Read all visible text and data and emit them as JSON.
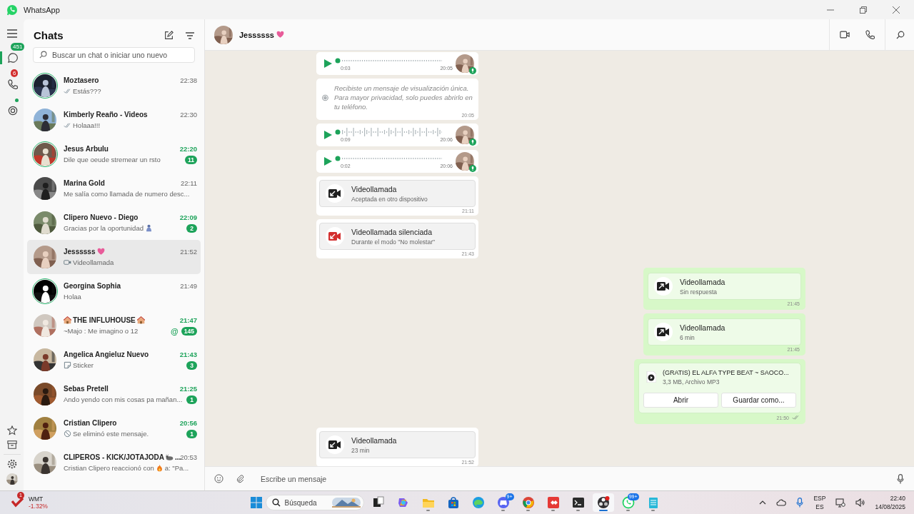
{
  "window": {
    "title": "WhatsApp"
  },
  "rail": {
    "items": [
      {
        "kind": "chats",
        "badge": "451",
        "selected": true
      },
      {
        "kind": "calls",
        "badge": "6",
        "selected": false
      },
      {
        "kind": "status",
        "dot": true,
        "selected": false
      }
    ]
  },
  "chat_list": {
    "title": "Chats",
    "search": {
      "placeholder": "Buscar un chat o iniciar uno nuevo"
    },
    "chats": [
      {
        "name": [
          {
            "kind": "text",
            "text": "Moztasero"
          }
        ],
        "time": "22:38",
        "preview": [
          {
            "kind": "ticks"
          },
          {
            "kind": "text",
            "text": "Estás???"
          }
        ],
        "status_ring": true,
        "selected": false
      },
      {
        "name": [
          {
            "kind": "text",
            "text": "Kimberly Reaño - Videos"
          }
        ],
        "time": "22:30",
        "preview": [
          {
            "kind": "ticks"
          },
          {
            "kind": "text",
            "text": "Holaaa!!!"
          }
        ],
        "status_ring": false,
        "selected": false
      },
      {
        "name": [
          {
            "kind": "text",
            "text": "Jesus Arbulu"
          }
        ],
        "time": "22:20",
        "preview": [
          {
            "kind": "text",
            "text": "Dile que oeude stremear un rsto"
          }
        ],
        "unread": "11",
        "status_ring": true,
        "selected": false
      },
      {
        "name": [
          {
            "kind": "text",
            "text": "Marina Gold"
          }
        ],
        "time": "22:11",
        "preview": [
          {
            "kind": "text",
            "text": "Me salía como llamada de numero desc..."
          }
        ],
        "status_ring": false,
        "selected": false
      },
      {
        "name": [
          {
            "kind": "text",
            "text": "Clipero Nuevo - Diego"
          }
        ],
        "time": "22:09",
        "preview": [
          {
            "kind": "text",
            "text": "Gracias por la oportunidad"
          },
          {
            "kind": "person"
          }
        ],
        "unread": "2",
        "status_ring": false,
        "selected": false
      },
      {
        "name": [
          {
            "kind": "text",
            "text": "Jessssss"
          },
          {
            "kind": "heart"
          }
        ],
        "time": "21:52",
        "preview": [
          {
            "kind": "video"
          },
          {
            "kind": "text",
            "text": "Videollamada"
          }
        ],
        "status_ring": false,
        "selected": true
      },
      {
        "name": [
          {
            "kind": "text",
            "text": "Georgina Sophia"
          }
        ],
        "time": "21:49",
        "preview": [
          {
            "kind": "text",
            "text": "Holaa"
          }
        ],
        "status_ring": true,
        "selected": false
      },
      {
        "name": [
          {
            "kind": "house"
          },
          {
            "kind": "text",
            "text": "THE INFLUHOUSE"
          },
          {
            "kind": "house"
          }
        ],
        "time": "21:47",
        "preview": [
          {
            "kind": "text",
            "text": "~Majo : Me imagino o 12"
          }
        ],
        "mention": "@",
        "unread": "145",
        "status_ring": false,
        "selected": false
      },
      {
        "name": [
          {
            "kind": "text",
            "text": "Angelica Angieluz Nuevo"
          }
        ],
        "time": "21:43",
        "preview": [
          {
            "kind": "sticker"
          },
          {
            "kind": "text",
            "text": "Sticker"
          }
        ],
        "unread": "3",
        "status_ring": false,
        "selected": false
      },
      {
        "name": [
          {
            "kind": "text",
            "text": "Sebas Pretell"
          }
        ],
        "time": "21:25",
        "preview": [
          {
            "kind": "text",
            "text": "Ando yendo con mis cosas pa mañan..."
          }
        ],
        "unread": "1",
        "status_ring": false,
        "selected": false
      },
      {
        "name": [
          {
            "kind": "text",
            "text": "Cristian Clipero"
          }
        ],
        "time": "20:56",
        "preview": [
          {
            "kind": "deleted"
          },
          {
            "kind": "text",
            "text": "Se eliminó este mensaje."
          }
        ],
        "unread": "1",
        "status_ring": false,
        "selected": false
      },
      {
        "name": [
          {
            "kind": "text",
            "text": "CLIPEROS - KICK/JOTAJODA"
          },
          {
            "kind": "animal"
          },
          {
            "kind": "text",
            "text": "..."
          }
        ],
        "time": "20:53",
        "preview": [
          {
            "kind": "text",
            "text": "Cristian Clipero reaccionó con"
          },
          {
            "kind": "fire"
          },
          {
            "kind": "text",
            "text": "a: \"Pa..."
          }
        ],
        "status_ring": false,
        "selected": false
      }
    ]
  },
  "conversation": {
    "contact": {
      "name": [
        {
          "kind": "text",
          "text": "Jessssss"
        },
        {
          "kind": "heart"
        }
      ]
    },
    "messages": [
      {
        "kind": "voice",
        "outgoing": false,
        "duration": "0:03",
        "time": "20:05"
      },
      {
        "kind": "view_once",
        "outgoing": false,
        "text": "Recibiste un mensaje de visualización única. Para mayor privacidad, solo puedes abrirlo en tu teléfono.",
        "time": "20:05"
      },
      {
        "kind": "voice",
        "outgoing": false,
        "duration": "0:09",
        "time": "20:06"
      },
      {
        "kind": "voice",
        "outgoing": false,
        "duration": "0:02",
        "time": "20:06"
      },
      {
        "kind": "call",
        "outgoing": false,
        "title": "Videollamada",
        "subtitle": "Aceptada en otro dispositivo",
        "time": "21:11",
        "missed": false
      },
      {
        "kind": "call",
        "outgoing": false,
        "title": "Videollamada silenciada",
        "subtitle": "Durante el modo \"No molestar\"",
        "time": "21:43",
        "missed": true
      },
      {
        "kind": "call",
        "outgoing": true,
        "title": "Videollamada",
        "subtitle": "Sin respuesta",
        "time": "21:45",
        "missed": false
      },
      {
        "kind": "call",
        "outgoing": true,
        "title": "Videollamada",
        "subtitle": "6 min",
        "time": "21:45",
        "missed": false
      },
      {
        "kind": "file",
        "outgoing": true,
        "name": "(GRATIS) EL ALFA TYPE BEAT ~ SAOCO...",
        "meta": "3,3 MB, Archivo MP3",
        "buttons": [
          "Abrir",
          "Guardar como..."
        ],
        "time": "21:50",
        "read": false
      },
      {
        "kind": "call",
        "outgoing": false,
        "title": "Videollamada",
        "subtitle": "23 min",
        "time": "21:52",
        "missed": false
      }
    ],
    "composer": {
      "placeholder": "Escribe un mensaje"
    }
  },
  "taskbar": {
    "widget": {
      "ticker": "WMT",
      "change": "-1.32%",
      "badge": "1"
    },
    "search": {
      "placeholder": "Búsqueda"
    },
    "apps": [
      {
        "kind": "taskview",
        "running": false,
        "selected": false
      },
      {
        "kind": "copilot",
        "running": false,
        "selected": false
      },
      {
        "kind": "folder",
        "running": true,
        "selected": false
      },
      {
        "kind": "store",
        "running": false,
        "selected": false
      },
      {
        "kind": "edge",
        "running": false,
        "selected": false
      },
      {
        "kind": "discord",
        "badge": "9+",
        "running": true,
        "selected": false
      },
      {
        "kind": "chrome",
        "running": true,
        "selected": false
      },
      {
        "kind": "anydesk",
        "running": true,
        "selected": false
      },
      {
        "kind": "terminal",
        "running": true,
        "selected": false
      },
      {
        "kind": "obs",
        "running": true,
        "selected": true
      },
      {
        "kind": "whatsapp",
        "badge": "99+",
        "running": true,
        "selected": false
      },
      {
        "kind": "notepad",
        "running": true,
        "selected": false
      }
    ],
    "tray": {
      "language": [
        "ESP",
        "ES"
      ],
      "clock": [
        "22:40",
        "14/08/2025"
      ]
    }
  }
}
